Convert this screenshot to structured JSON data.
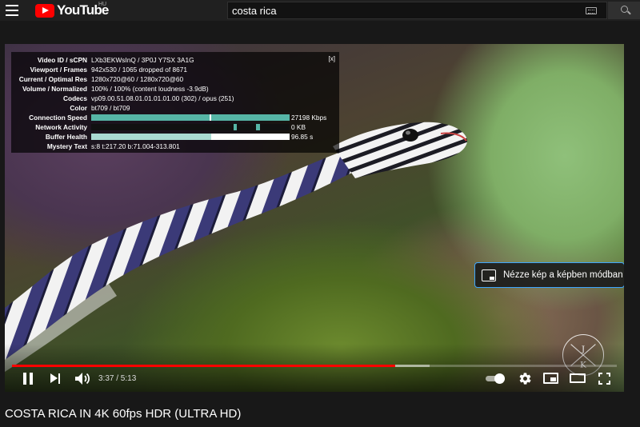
{
  "masthead": {
    "logo_text": "YouTube",
    "country_code": "HU",
    "search": {
      "value": "costa rica",
      "placeholder": "Search"
    }
  },
  "player": {
    "stats": {
      "rows": [
        {
          "key": "Video ID / sCPN",
          "value": "LXb3EKWsInQ / 3P0J Y7SX 3A1G"
        },
        {
          "key": "Viewport / Frames",
          "value": "942x530 / 1065 dropped of 8671"
        },
        {
          "key": "Current / Optimal Res",
          "value": "1280x720@60 / 1280x720@60"
        },
        {
          "key": "Volume / Normalized",
          "value": "100% / 100% (content loudness -3.9dB)"
        },
        {
          "key": "Codecs",
          "value": "vp09.00.51.08.01.01.01.01.00 (302) / opus (251)"
        },
        {
          "key": "Color",
          "value": "bt709 / bt709"
        },
        {
          "key": "Connection Speed",
          "value": "27198 Kbps"
        },
        {
          "key": "Network Activity",
          "value": "0 KB"
        },
        {
          "key": "Buffer Health",
          "value": "96.85 s"
        },
        {
          "key": "Mystery Text",
          "value": "s:8 t:217.20 b:71.004-313.801"
        }
      ],
      "close_label": "[x]"
    },
    "pip_tooltip": "Nézze kép a képben módban",
    "watermark_letters": [
      "J",
      "K"
    ],
    "progress": {
      "played_fraction": 0.634,
      "buffered_fraction": 0.69
    },
    "time_display": "3:37 / 5:13",
    "colors": {
      "progress_played": "#ff0000",
      "stats_bar": "#56b5a6",
      "tooltip_border": "#3ea6ff"
    }
  },
  "video_title": "COSTA RICA IN 4K 60fps HDR (ULTRA HD)"
}
